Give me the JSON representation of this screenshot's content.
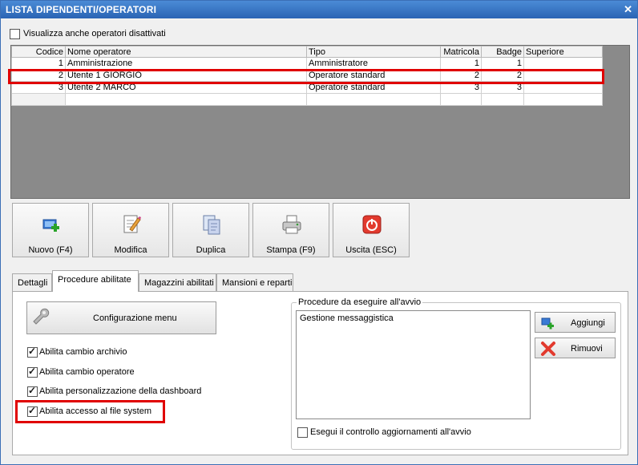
{
  "window": {
    "title": "LISTA DIPENDENTI/OPERATORI",
    "close_icon": "✕"
  },
  "show_disabled": {
    "label": "Visualizza anche operatori disattivati",
    "checked": false
  },
  "grid": {
    "columns": [
      "Codice",
      "Nome operatore",
      "Tipo",
      "Matricola",
      "Badge",
      "Superiore"
    ],
    "rows": [
      [
        "1",
        "Amministrazione",
        "Amministratore",
        "1",
        "1",
        ""
      ],
      [
        "2",
        "Utente 1 GIORGIO",
        "Operatore standard",
        "2",
        "2",
        ""
      ],
      [
        "3",
        "Utente 2 MARCO",
        "Operatore standard",
        "3",
        "3",
        ""
      ]
    ],
    "highlighted_row": 1
  },
  "toolbar": {
    "new_label": "Nuovo (F4)",
    "edit_label": "Modifica",
    "duplicate_label": "Duplica",
    "print_label": "Stampa (F9)",
    "exit_label": "Uscita (ESC)"
  },
  "tabs": [
    "Dettagli",
    "Procedure abilitate",
    "Magazzini abilitati",
    "Mansioni e reparti"
  ],
  "active_tab": 1,
  "procedures": {
    "config_menu_label": "Configurazione menu",
    "options": [
      {
        "label": "Abilita cambio archivio",
        "checked": true
      },
      {
        "label": "Abilita cambio operatore",
        "checked": true
      },
      {
        "label": "Abilita personalizzazione della dashboard",
        "checked": true
      },
      {
        "label": "Abilita accesso al file system",
        "checked": true
      }
    ],
    "startup_group_label": "Procedure da eseguire all'avvio",
    "startup_items": [
      "Gestione messaggistica"
    ],
    "add_label": "Aggiungi",
    "remove_label": "Rimuovi",
    "update_check_label": "Esegui il controllo aggiornamenti all'avvio",
    "update_check_checked": false
  },
  "colors": {
    "titlebar": "#2a64b4",
    "highlight": "#e00000"
  }
}
